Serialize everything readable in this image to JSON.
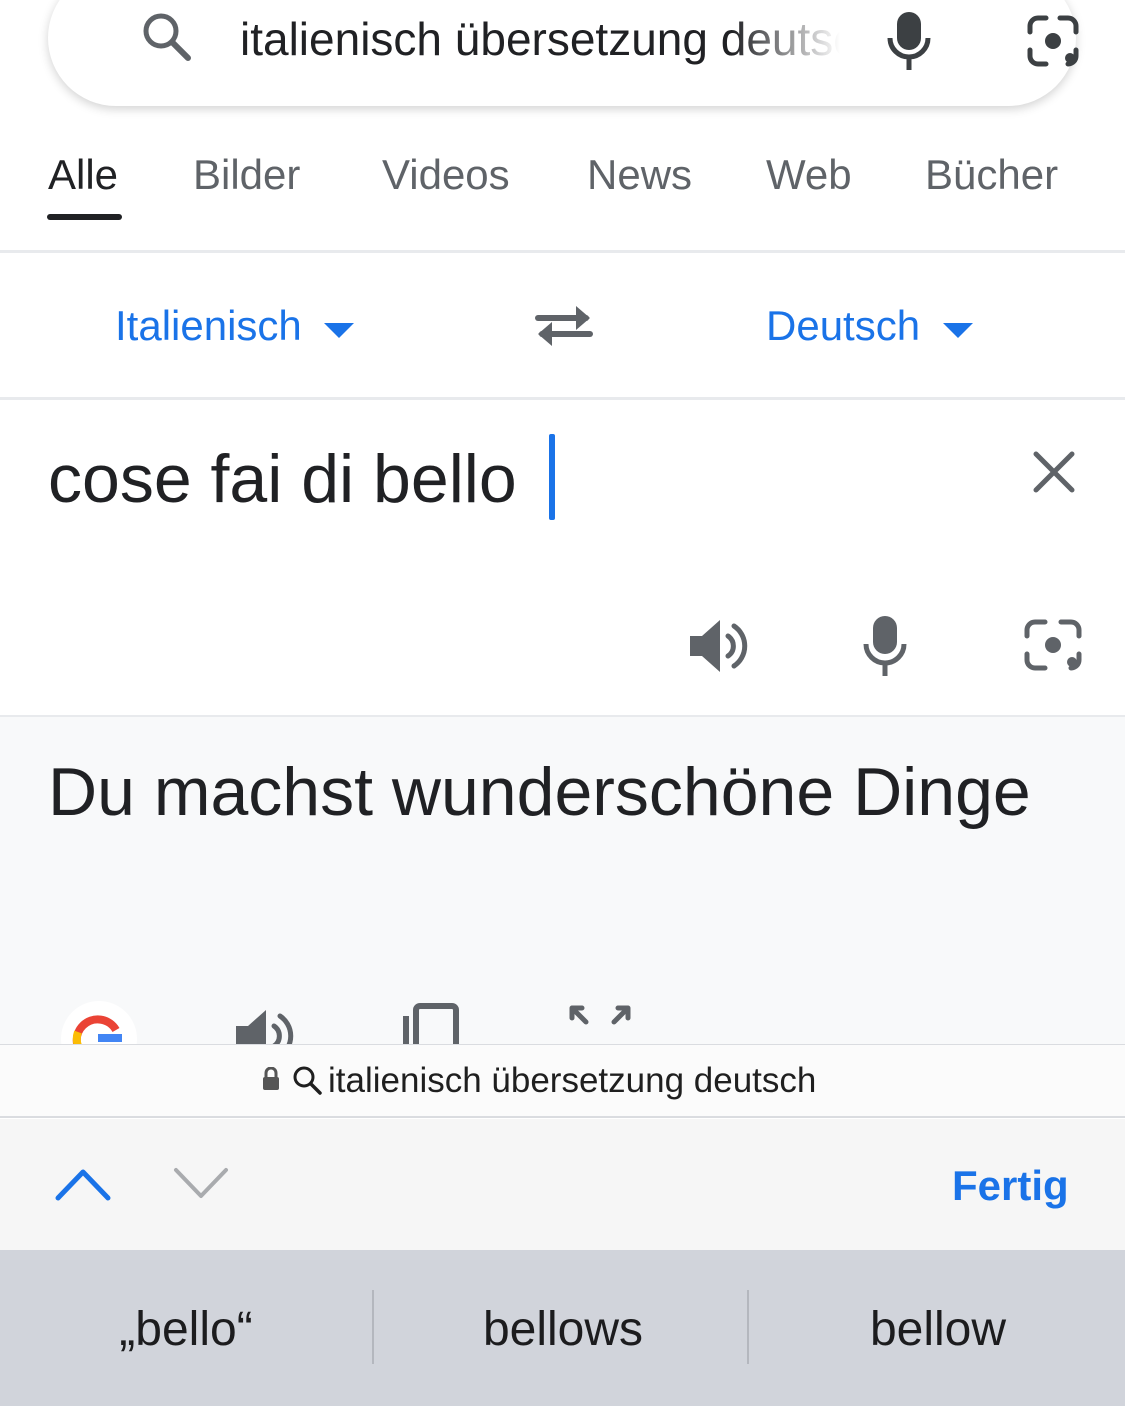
{
  "search": {
    "query": "italienisch übersetzung deutsch"
  },
  "tabs": [
    {
      "label": "Alle",
      "active": true
    },
    {
      "label": "Bilder",
      "active": false
    },
    {
      "label": "Videos",
      "active": false
    },
    {
      "label": "News",
      "active": false
    },
    {
      "label": "Web",
      "active": false
    },
    {
      "label": "Bücher",
      "active": false
    }
  ],
  "translator": {
    "source_language": "Italienisch",
    "target_language": "Deutsch",
    "source_text": "cose fai di bello",
    "translation": "Du machst wunderschöne Dinge"
  },
  "address_bar": {
    "text": "italienisch übersetzung deutsch"
  },
  "toolbar": {
    "done_label": "Fertig"
  },
  "suggestions": [
    "„bello“",
    "bellows",
    "bellow"
  ],
  "colors": {
    "accent": "#1a73e8",
    "icon_gray": "#5f6368",
    "keyboard_bg": "#d1d4db"
  },
  "icons": [
    "search-icon",
    "microphone-icon",
    "camera-lens-icon",
    "swap-icon",
    "close-icon",
    "speaker-icon",
    "copy-icon",
    "expand-icon",
    "google-logo",
    "lock-icon",
    "chevron-up-icon",
    "chevron-down-icon"
  ]
}
